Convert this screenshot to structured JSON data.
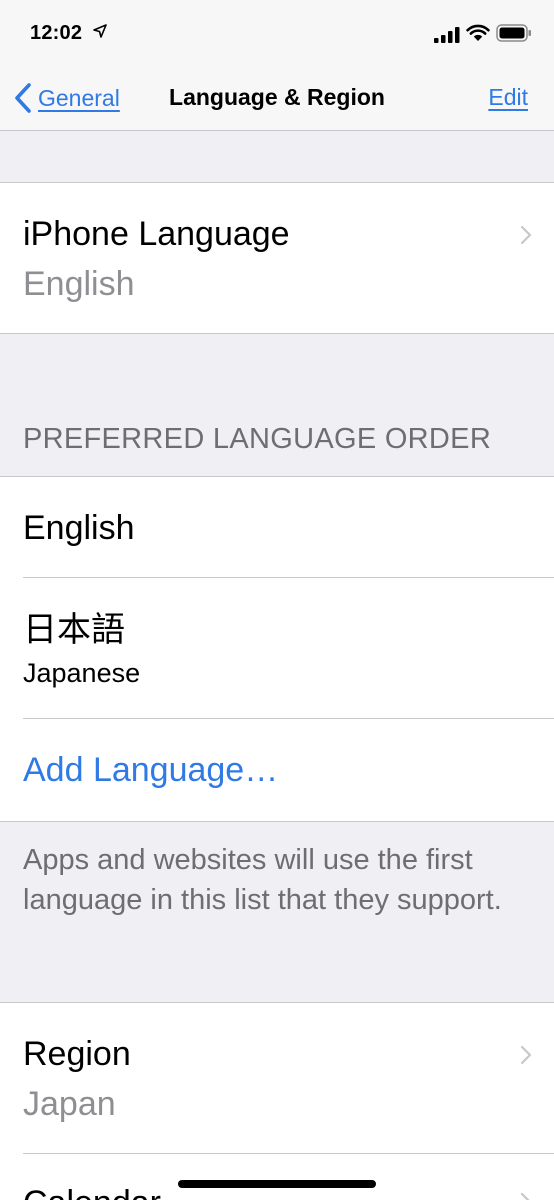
{
  "status_bar": {
    "time": "12:02",
    "icons": [
      "location-icon",
      "signal-icon",
      "wifi-icon",
      "battery-icon"
    ]
  },
  "nav": {
    "back_label": "General",
    "title": "Language & Region",
    "edit_label": "Edit"
  },
  "iphone_language": {
    "title": "iPhone Language",
    "value": "English"
  },
  "preferred": {
    "header": "PREFERRED LANGUAGE ORDER",
    "languages": [
      {
        "name": "English",
        "subtitle": ""
      },
      {
        "name": "日本語",
        "subtitle": "Japanese"
      }
    ],
    "add_label": "Add Language…",
    "footer": "Apps and websites will use the first language in this list that they support."
  },
  "region": {
    "title": "Region",
    "value": "Japan"
  },
  "calendar": {
    "title": "Calendar"
  },
  "colors": {
    "accent": "#2f7ae5",
    "background": "#efeff4",
    "secondary_text": "#8e8e93"
  }
}
